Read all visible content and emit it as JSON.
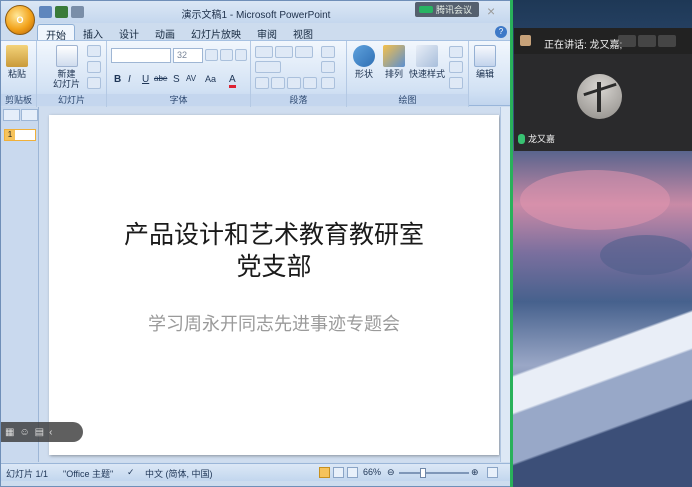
{
  "ppt": {
    "window_title": "演示文稿1 - Microsoft PowerPoint",
    "office_button_label": "O",
    "tabs": [
      "开始",
      "插入",
      "设计",
      "动画",
      "幻灯片放映",
      "审阅",
      "视图"
    ],
    "active_tab": "开始",
    "ribbon": {
      "paste_label": "粘贴",
      "new_slide_label": "新建\n幻灯片",
      "font_size_value": "32",
      "shape_label": "形状",
      "arrange_label": "排列",
      "quick_styles_label": "快速样式",
      "editing_label": "编辑",
      "format_buttons": [
        "B",
        "I",
        "U",
        "abe",
        "S",
        "AV",
        "Aa",
        "A"
      ],
      "groups": {
        "clipboard": "剪贴板",
        "slides": "幻灯片",
        "font": "字体",
        "paragraph": "段落",
        "drawing": "绘图"
      }
    },
    "slide": {
      "title_line1": "产品设计和艺术教育教研室",
      "title_line2": "党支部",
      "subtitle": "学习周永开同志先进事迹专题会"
    },
    "statusbar": {
      "slide_counter": "幻灯片 1/1",
      "theme": "\"Office 主题\"",
      "language": "中文 (简体, 中国)",
      "zoom": "66%",
      "zoom_fraction": 0.66
    }
  },
  "meeting": {
    "app_badge": "腾讯会议",
    "speaking_label": "正在讲话: 龙又嘉;",
    "participant_name": "龙又嘉",
    "accent_color": "#29b15a"
  }
}
